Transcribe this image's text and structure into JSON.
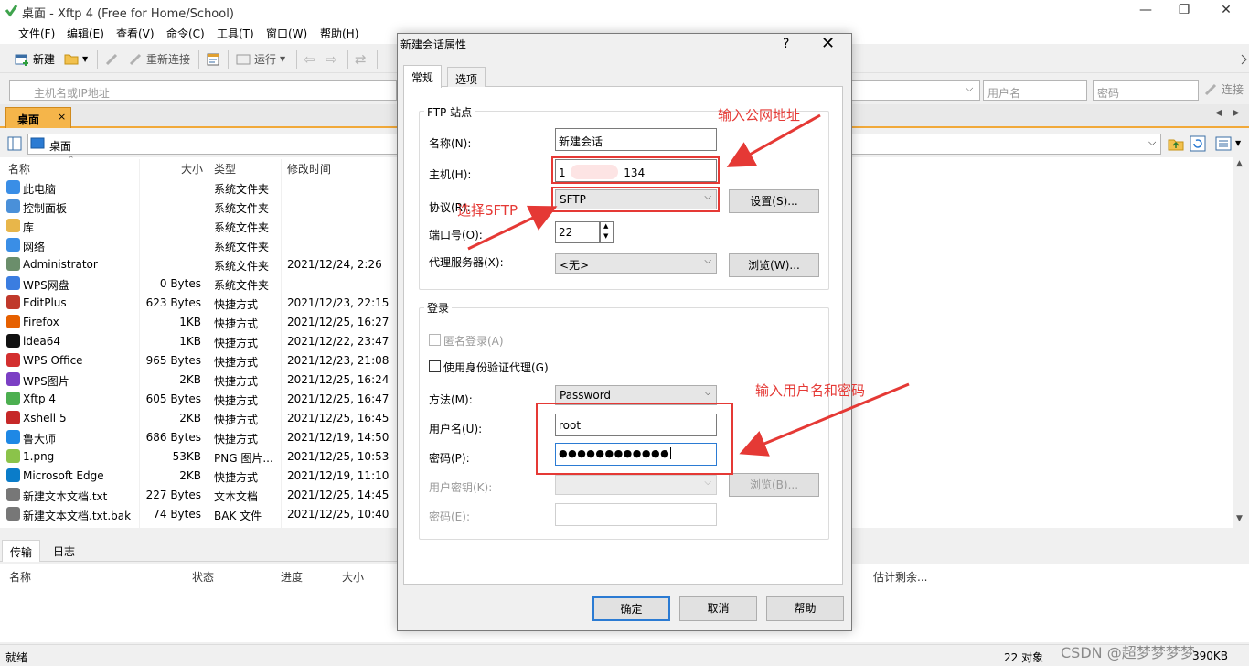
{
  "window": {
    "title": "桌面 - Xftp 4 (Free for Home/School)",
    "minimize": "—",
    "maximize": "❐",
    "close": "✕"
  },
  "menu": [
    "文件(F)",
    "编辑(E)",
    "查看(V)",
    "命令(C)",
    "工具(T)",
    "窗口(W)",
    "帮助(H)"
  ],
  "toolbar": {
    "new_label": "新建",
    "reconnect_label": "重新连接",
    "run_label": "运行"
  },
  "address": {
    "host_placeholder": "主机名或IP地址",
    "username_placeholder": "用户名",
    "password_placeholder": "密码",
    "connect_label": "连接"
  },
  "tab": {
    "label": "桌面"
  },
  "path": {
    "value": "桌面"
  },
  "filelist": {
    "columns": {
      "name": "名称",
      "size": "大小",
      "type": "类型",
      "modified": "修改时间"
    },
    "rows": [
      {
        "name": "此电脑",
        "size": "",
        "type": "系统文件夹",
        "modified": "",
        "icon": "computer-icon",
        "color": "#3a8ee6"
      },
      {
        "name": "控制面板",
        "size": "",
        "type": "系统文件夹",
        "modified": "",
        "icon": "control-panel-icon",
        "color": "#4a90d9"
      },
      {
        "name": "库",
        "size": "",
        "type": "系统文件夹",
        "modified": "",
        "icon": "library-icon",
        "color": "#e8b64a"
      },
      {
        "name": "网络",
        "size": "",
        "type": "系统文件夹",
        "modified": "",
        "icon": "network-icon",
        "color": "#3a8ee6"
      },
      {
        "name": "Administrator",
        "size": "",
        "type": "系统文件夹",
        "modified": "2021/12/24, 2:26",
        "icon": "user-icon",
        "color": "#6b8e6b"
      },
      {
        "name": "WPS网盘",
        "size": "0 Bytes",
        "type": "系统文件夹",
        "modified": "",
        "icon": "cloud-icon",
        "color": "#3b7de0"
      },
      {
        "name": "EditPlus",
        "size": "623 Bytes",
        "type": "快捷方式",
        "modified": "2021/12/23, 22:15",
        "icon": "editplus-icon",
        "color": "#c0392b"
      },
      {
        "name": "Firefox",
        "size": "1KB",
        "type": "快捷方式",
        "modified": "2021/12/25, 16:27",
        "icon": "firefox-icon",
        "color": "#e66000"
      },
      {
        "name": "idea64",
        "size": "1KB",
        "type": "快捷方式",
        "modified": "2021/12/22, 23:47",
        "icon": "idea-icon",
        "color": "#111111"
      },
      {
        "name": "WPS Office",
        "size": "965 Bytes",
        "type": "快捷方式",
        "modified": "2021/12/23, 21:08",
        "icon": "wps-office-icon",
        "color": "#d32f2f"
      },
      {
        "name": "WPS图片",
        "size": "2KB",
        "type": "快捷方式",
        "modified": "2021/12/25, 16:24",
        "icon": "wps-picture-icon",
        "color": "#7b3fc4"
      },
      {
        "name": "Xftp 4",
        "size": "605 Bytes",
        "type": "快捷方式",
        "modified": "2021/12/25, 16:47",
        "icon": "xftp-icon",
        "color": "#4caf50"
      },
      {
        "name": "Xshell 5",
        "size": "2KB",
        "type": "快捷方式",
        "modified": "2021/12/25, 16:45",
        "icon": "xshell-icon",
        "color": "#c62828"
      },
      {
        "name": "鲁大师",
        "size": "686 Bytes",
        "type": "快捷方式",
        "modified": "2021/12/19, 14:50",
        "icon": "ludashi-icon",
        "color": "#1e88e5"
      },
      {
        "name": "1.png",
        "size": "53KB",
        "type": "PNG 图片...",
        "modified": "2021/12/25, 10:53",
        "icon": "image-icon",
        "color": "#8bc34a"
      },
      {
        "name": "Microsoft Edge",
        "size": "2KB",
        "type": "快捷方式",
        "modified": "2021/12/19, 11:10",
        "icon": "edge-icon",
        "color": "#0a7cc9"
      },
      {
        "name": "新建文本文档.txt",
        "size": "227 Bytes",
        "type": "文本文档",
        "modified": "2021/12/25, 14:45",
        "icon": "text-file-icon",
        "color": "#777777"
      },
      {
        "name": "新建文本文档.txt.bak",
        "size": "74 Bytes",
        "type": "BAK 文件",
        "modified": "2021/12/25, 10:40",
        "icon": "file-icon",
        "color": "#777777"
      }
    ]
  },
  "bottom": {
    "tabs": [
      "传输",
      "日志"
    ],
    "columns": {
      "name": "名称",
      "status": "状态",
      "progress": "进度",
      "size": "大小",
      "remaining": "估计剩余..."
    }
  },
  "status": {
    "left": "就绪",
    "objects": "22 对象",
    "size": "390KB",
    "watermark": "CSDN @超梦梦梦梦"
  },
  "dialog": {
    "title": "新建会话属性",
    "help": "?",
    "close": "✕",
    "tabs": [
      "常规",
      "选项"
    ],
    "ftp_group": "FTP 站点",
    "name_label": "名称(N):",
    "name_value": "新建会话",
    "host_label": "主机(H):",
    "host_prefix": "1",
    "host_suffix": "134",
    "protocol_label": "协议(R):",
    "protocol_value": "SFTP",
    "settings_btn": "设置(S)...",
    "port_label": "端口号(O):",
    "port_value": "22",
    "proxy_label": "代理服务器(X):",
    "proxy_value": "<无>",
    "browse_btn": "浏览(W)...",
    "login_group": "登录",
    "anon_label": "匿名登录(A)",
    "agent_label": "使用身份验证代理(G)",
    "method_label": "方法(M):",
    "method_value": "Password",
    "user_label": "用户名(U):",
    "user_value": "root",
    "pass_label": "密码(P):",
    "pass_value": "●●●●●●●●●●●●",
    "key_label": "用户密钥(K):",
    "key_browse_btn": "浏览(B)...",
    "passphrase_label": "密码(E):",
    "ok_btn": "确定",
    "cancel_btn": "取消",
    "help_btn": "帮助"
  },
  "annotations": {
    "host": "输入公网地址",
    "protocol": "选择SFTP",
    "credentials": "输入用户名和密码"
  },
  "colors": {
    "annotation_red": "#e53935",
    "tab_orange": "#f5b54a",
    "dialog_bg": "#f0f0f0"
  }
}
